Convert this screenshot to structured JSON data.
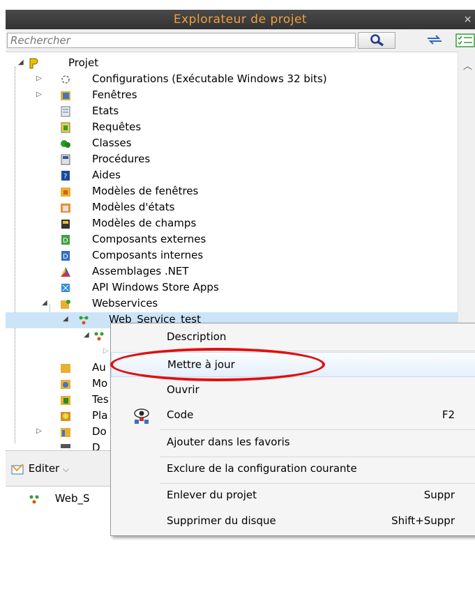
{
  "panel": {
    "title": "Explorateur de projet",
    "close": "×"
  },
  "search": {
    "placeholder": "Rechercher"
  },
  "tree": {
    "root": "Projet",
    "items": [
      "Configurations (Exécutable Windows 32 bits)",
      "Fenêtres",
      "Etats",
      "Requêtes",
      "Classes",
      "Procédures",
      "Aides",
      "Modèles de fenêtres",
      "Modèles d'états",
      "Modèles de champs",
      "Composants externes",
      "Composants internes",
      "Assemblages .NET",
      "API Windows Store Apps",
      "Webservices"
    ],
    "webservice": "Web_Service_test",
    "partial_items": [
      "Au",
      "Mo",
      "Tes",
      "Pla",
      "Do",
      "D"
    ]
  },
  "toolbar2": {
    "edit_label": "Editer"
  },
  "bottom": {
    "item": "Web_S"
  },
  "menu": {
    "items": [
      {
        "label": "Description",
        "shortcut": ""
      },
      {
        "label": "Mettre à jour",
        "shortcut": ""
      },
      {
        "label": "Ouvrir",
        "shortcut": ""
      },
      {
        "label": "Code",
        "shortcut": "F2"
      },
      {
        "label": "Ajouter dans les favoris",
        "shortcut": ""
      },
      {
        "label": "Exclure de la configuration courante",
        "shortcut": ""
      },
      {
        "label": "Enlever du projet",
        "shortcut": "Suppr"
      },
      {
        "label": "Supprimer du disque",
        "shortcut": "Shift+Suppr"
      }
    ]
  },
  "colors": {
    "title_bg": "#3a3a3a",
    "title_text": "#f0a040",
    "highlight_circle": "#e01010",
    "selection": "#cce4f7"
  }
}
